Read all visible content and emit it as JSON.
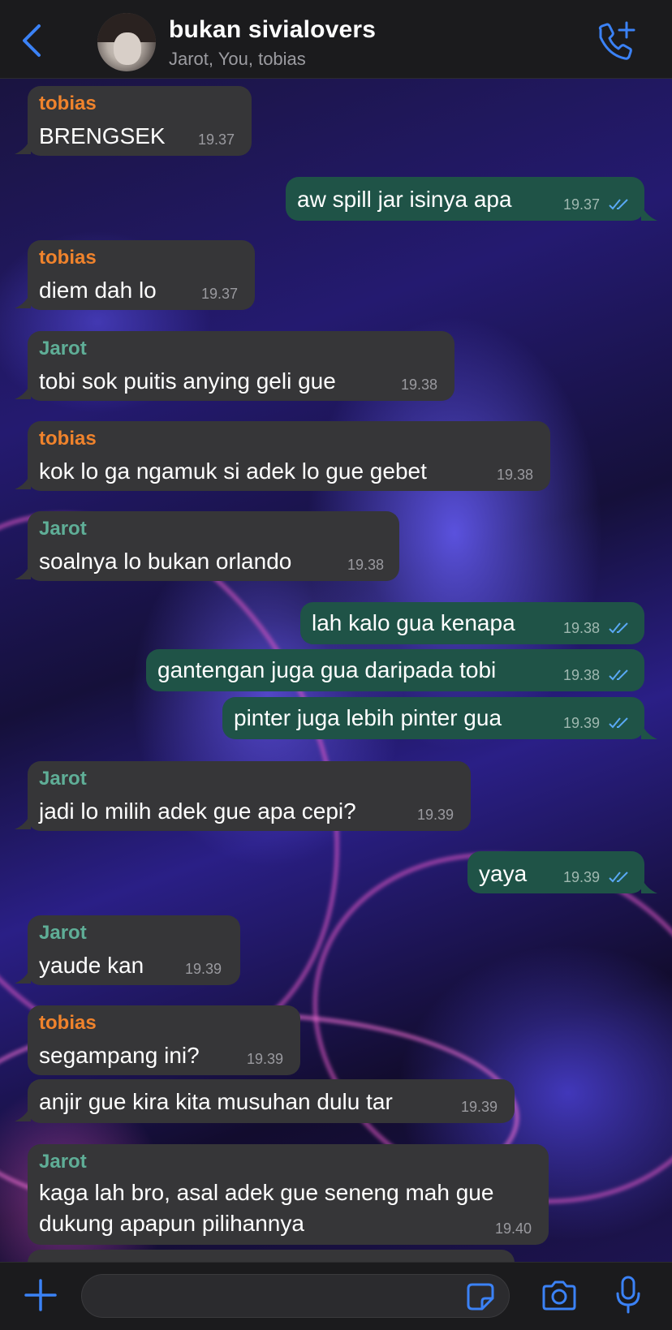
{
  "header": {
    "title": "bukan sivialovers",
    "subtitle": "Jarot, You, tobias"
  },
  "messages": [
    {
      "sender": "tobias",
      "text": "BRENGSEK",
      "time": "19.37"
    },
    {
      "sender": "You",
      "text": "aw spill jar isinya apa",
      "time": "19.37"
    },
    {
      "sender": "tobias",
      "text": "diem dah lo",
      "time": "19.37"
    },
    {
      "sender": "Jarot",
      "text": "tobi sok puitis anying geli gue",
      "time": "19.38"
    },
    {
      "sender": "tobias",
      "text": "kok lo ga ngamuk si adek lo gue gebet",
      "time": "19.38"
    },
    {
      "sender": "Jarot",
      "text": "soalnya lo bukan orlando",
      "time": "19.38"
    },
    {
      "sender": "You",
      "text": "lah kalo gua kenapa",
      "time": "19.38"
    },
    {
      "sender": "You",
      "text": "gantengan juga gua daripada tobi",
      "time": "19.38"
    },
    {
      "sender": "You",
      "text": "pinter juga lebih pinter gua",
      "time": "19.39"
    },
    {
      "sender": "Jarot",
      "text": "jadi lo milih adek gue apa cepi?",
      "time": "19.39"
    },
    {
      "sender": "You",
      "text": "yaya",
      "time": "19.39"
    },
    {
      "sender": "Jarot",
      "text": "yaude kan",
      "time": "19.39"
    },
    {
      "sender": "tobias",
      "text": "segampang ini?",
      "time": "19.39"
    },
    {
      "sender": "tobias",
      "text": "anjir gue kira kita musuhan dulu tar",
      "time": "19.39"
    },
    {
      "sender": "Jarot",
      "text_line1": "kaga lah bro, asal adek gue seneng mah gue",
      "text_line2": "dukung apapun pilihannya",
      "time": "19.40"
    }
  ],
  "composer": {
    "placeholder": "",
    "value": ""
  },
  "colors": {
    "accent": "#3b82f6",
    "incoming_bubble": "#363638",
    "outgoing_bubble": "#1f5347",
    "sender_tobias": "#f0832c",
    "sender_jarot": "#5fae97"
  },
  "icons": [
    "back-chevron-icon",
    "add-call-icon",
    "plus-icon",
    "sticker-icon",
    "camera-icon",
    "microphone-icon",
    "read-ticks-icon"
  ]
}
